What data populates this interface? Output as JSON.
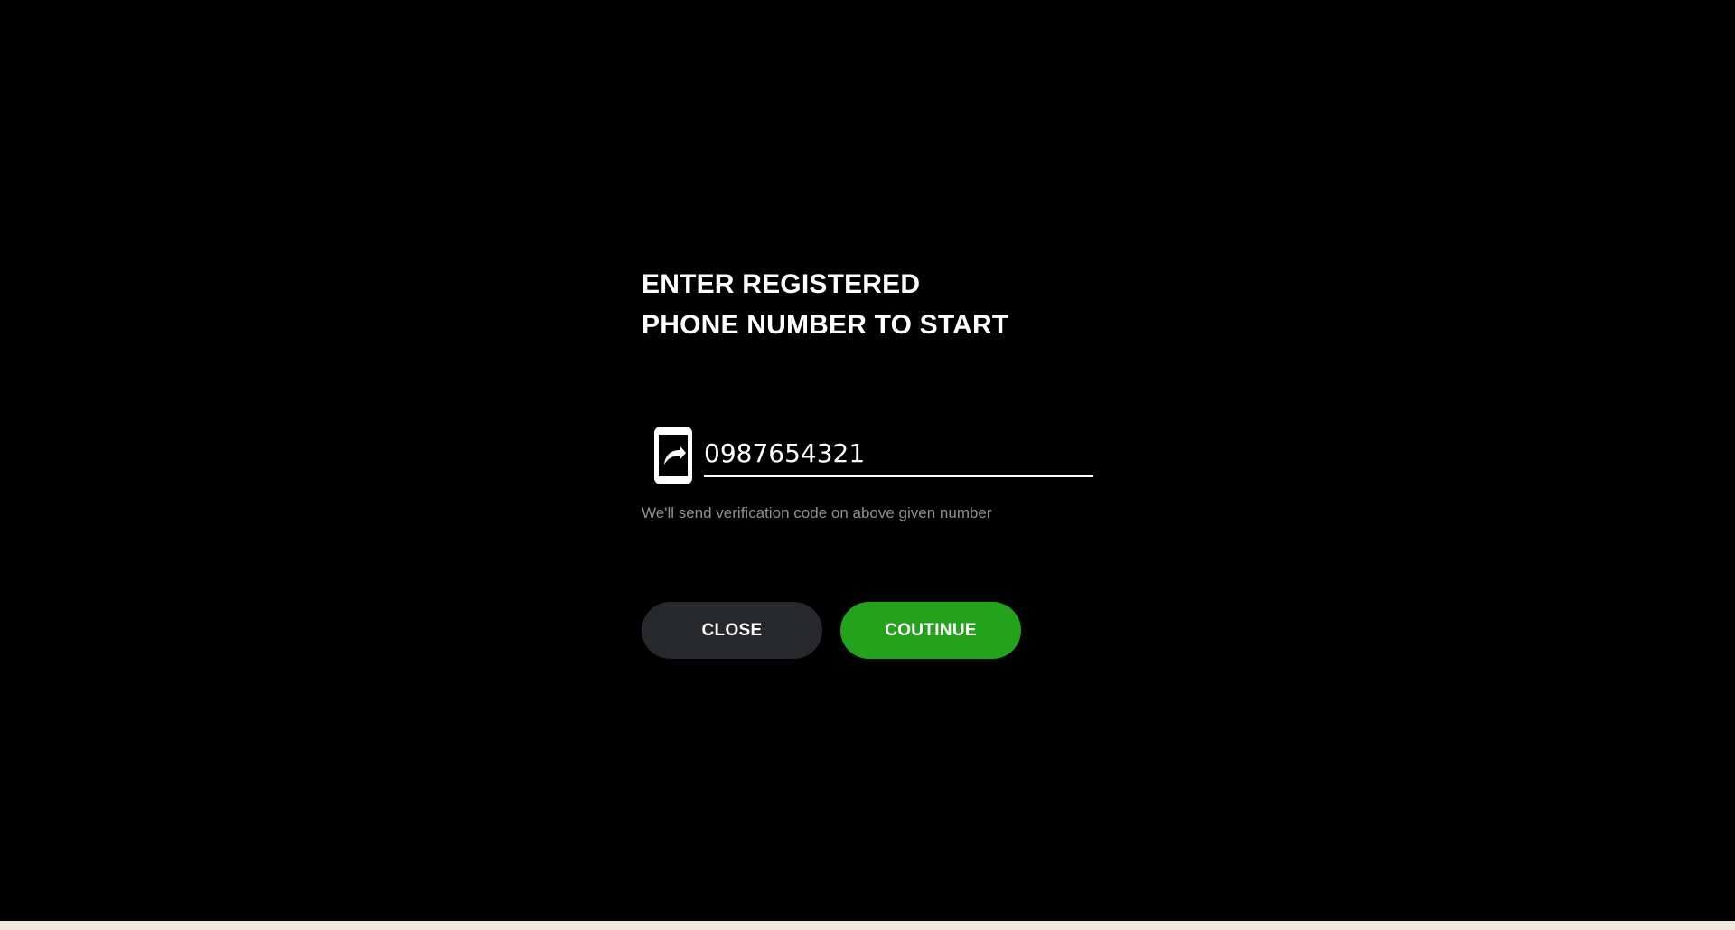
{
  "heading": {
    "line1": "ENTER REGISTERED",
    "line2": "PHONE NUMBER TO START"
  },
  "phone": {
    "icon": "phone-forward-icon",
    "value": "0987654321",
    "helper": "We'll send verification code on above given number"
  },
  "actions": {
    "close_label": "CLOSE",
    "continue_label": "COUTINUE"
  },
  "colors": {
    "background": "#000000",
    "close_button": "#27282c",
    "continue_button": "#22a31b",
    "helper_text": "#8f8f8f"
  }
}
